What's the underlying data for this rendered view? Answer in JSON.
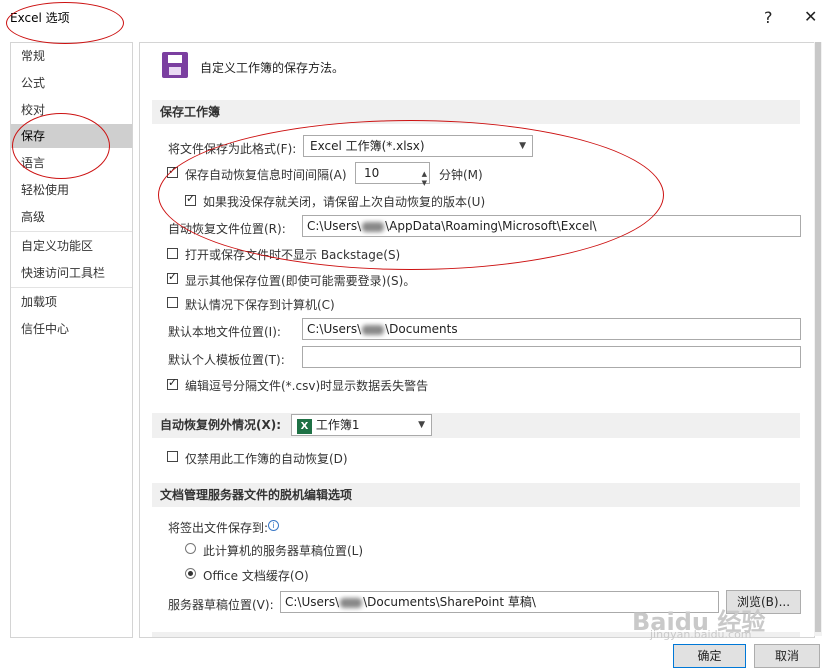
{
  "window": {
    "title": "Excel 选项",
    "help_symbol": "?",
    "close_symbol": "✕"
  },
  "sidebar": {
    "items": [
      {
        "label": "常规",
        "selected": false
      },
      {
        "label": "公式",
        "selected": false
      },
      {
        "label": "校对",
        "selected": false
      },
      {
        "label": "保存",
        "selected": true
      },
      {
        "label": "语言",
        "selected": false
      },
      {
        "label": "轻松使用",
        "selected": false
      },
      {
        "label": "高级",
        "selected": false
      },
      {
        "label": "自定义功能区",
        "selected": false
      },
      {
        "label": "快速访问工具栏",
        "selected": false
      },
      {
        "label": "加载项",
        "selected": false
      },
      {
        "label": "信任中心",
        "selected": false
      }
    ]
  },
  "main": {
    "header": "自定义工作簿的保存方法。",
    "save_section": {
      "title": "保存工作簿",
      "format_label": "将文件保存为此格式(F):",
      "format_value": "Excel 工作簿(*.xlsx)",
      "autorecover_label": "保存自动恢复信息时间间隔(A)",
      "autorecover_checked": true,
      "autorecover_minutes": "10",
      "minutes_label": "分钟(M)",
      "keep_last_label": "如果我没保存就关闭，请保留上次自动恢复的版本(U)",
      "keep_last_checked": true,
      "autorecover_location_label": "自动恢复文件位置(R):",
      "autorecover_location_prefix": "C:\\Users\\",
      "autorecover_location_suffix": "\\AppData\\Roaming\\Microsoft\\Excel\\",
      "no_backstage_label": "打开或保存文件时不显示 Backstage(S)",
      "no_backstage_checked": false,
      "show_other_label": "显示其他保存位置(即使可能需要登录)(S)。",
      "show_other_checked": true,
      "default_computer_label": "默认情况下保存到计算机(C)",
      "default_computer_checked": false,
      "default_local_label": "默认本地文件位置(I):",
      "default_local_prefix": "C:\\Users\\",
      "default_local_suffix": "\\Documents",
      "template_label": "默认个人模板位置(T):",
      "template_value": "",
      "csv_warning_label": "编辑逗号分隔文件(*.csv)时显示数据丢失警告",
      "csv_warning_checked": true
    },
    "exceptions_section": {
      "title": "自动恢复例外情况(X):",
      "workbook_icon": "X",
      "workbook_value": "工作簿1",
      "disable_label": "仅禁用此工作簿的自动恢复(D)",
      "disable_checked": false
    },
    "offline_section": {
      "title": "文档管理服务器文件的脱机编辑选项",
      "checkout_label": "将签出文件保存到:",
      "info_icon": "i",
      "radio_server_label": "此计算机的服务器草稿位置(L)",
      "radio_server_checked": false,
      "radio_cache_label": "Office 文档缓存(O)",
      "radio_cache_checked": true,
      "drafts_label": "服务器草稿位置(V):",
      "drafts_prefix": "C:\\Users\\",
      "drafts_suffix": "\\Documents\\SharePoint 草稿\\",
      "browse_label": "浏览(B)..."
    }
  },
  "footer": {
    "ok_label": "确定",
    "cancel_label": "取消"
  },
  "watermark": {
    "brand": "Baidu 经验",
    "url": "jingyan.baidu.com"
  },
  "colors": {
    "selected_nav": "#cfcfcf",
    "section_bg": "#f0f0f0",
    "annotation": "#cc1111",
    "save_icon": "#7b3fa0",
    "excel_green": "#1e7145"
  }
}
